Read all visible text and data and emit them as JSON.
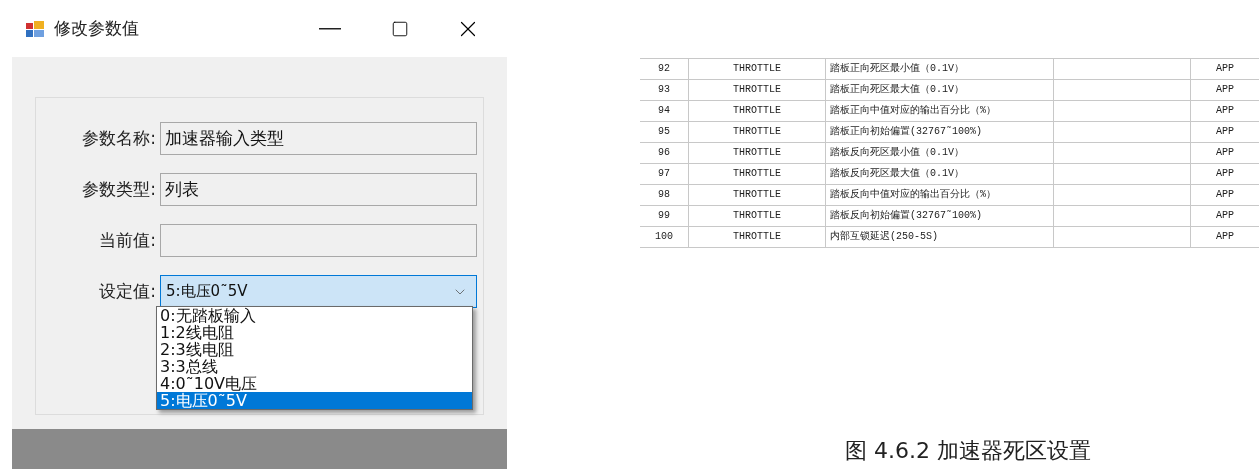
{
  "dialog": {
    "title": "修改参数值",
    "fields": [
      {
        "label": "参数名称:",
        "value": "加速器输入类型"
      },
      {
        "label": "参数类型:",
        "value": "列表"
      },
      {
        "label": "当前值:"
      }
    ],
    "combo": {
      "label": "设定值:",
      "value": "5:电压0˜5V",
      "expanded": true,
      "options": [
        {
          "label": "0:无踏板输入",
          "selected": false
        },
        {
          "label": "1:2线电阻",
          "selected": false
        },
        {
          "label": "2:3线电阻",
          "selected": false
        },
        {
          "label": "3:3总线",
          "selected": false
        },
        {
          "label": "4:0˜10V电压",
          "selected": false
        },
        {
          "label": "5:电压0˜5V",
          "selected": true
        }
      ]
    }
  },
  "table": {
    "rows": [
      {
        "cells": [
          "92",
          "THROTTLE",
          "踏板正向死区最小值（0.1V）",
          "",
          "APP"
        ]
      },
      {
        "cells": [
          "93",
          "THROTTLE",
          "踏板正向死区最大值（0.1V）",
          "",
          "APP"
        ]
      },
      {
        "cells": [
          "94",
          "THROTTLE",
          "踏板正向中值对应的输出百分比（%）",
          "",
          "APP"
        ]
      },
      {
        "cells": [
          "95",
          "THROTTLE",
          "踏板正向初始偏置(32767˜100%)",
          "",
          "APP"
        ]
      },
      {
        "cells": [
          "96",
          "THROTTLE",
          "踏板反向死区最小值（0.1V）",
          "",
          "APP"
        ]
      },
      {
        "cells": [
          "97",
          "THROTTLE",
          "踏板反向死区最大值（0.1V）",
          "",
          "APP"
        ]
      },
      {
        "cells": [
          "98",
          "THROTTLE",
          "踏板反向中值对应的输出百分比（%）",
          "",
          "APP"
        ]
      },
      {
        "cells": [
          "99",
          "THROTTLE",
          "踏板反向初始偏置(32767˜100%)",
          "",
          "APP"
        ]
      },
      {
        "cells": [
          "100",
          "THROTTLE",
          "内部互锁延迟(250-5S)",
          "",
          "APP"
        ]
      }
    ]
  },
  "caption": "图 4.6.2 加速器死区设置"
}
